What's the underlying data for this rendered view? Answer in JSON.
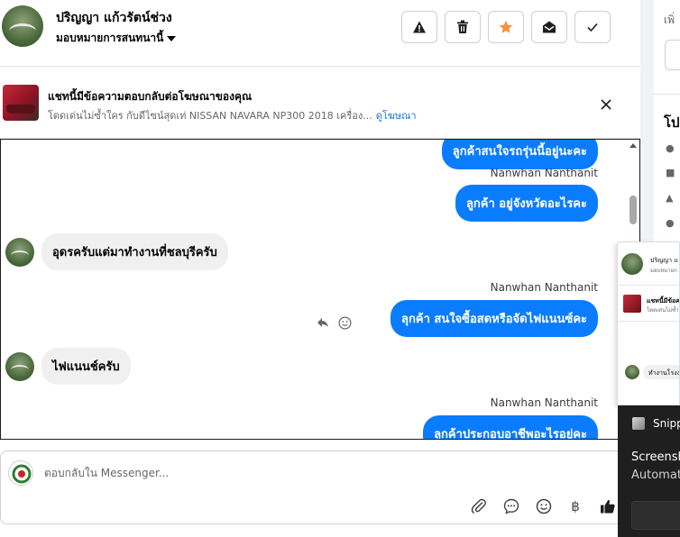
{
  "header": {
    "contact_name": "ปริญญา แก้วรัตน์ช่วง",
    "assign_label": "มอบหมายการสนทนานี้"
  },
  "ad_banner": {
    "title": "แชทนี้มีข้อความตอบกลับต่อโฆษณาของคุณ",
    "description": "โดดเด่นไม่ซ้ำใคร กับดีไซน์สุดเท่ NISSAN NAVARA NP300 2018 เครื่อง...",
    "link": "ดูโฆษณา"
  },
  "messages": [
    {
      "direction": "out",
      "text": "ลูกค้าสนใจรถรุ่นนี้อยู่นะคะ",
      "sender": ""
    },
    {
      "direction": "out",
      "text": "ลูกค้า อยู่จังหวัดอะไรคะ",
      "sender": "Nanwhan Nanthanit"
    },
    {
      "direction": "in",
      "text": "อุดรครับแต่มาทำงานที่ชลบุรีครับ",
      "sender": ""
    },
    {
      "direction": "out",
      "text": "ลุกค้า สนใจซื้อสดหรือจัดไฟแนนซ์คะ",
      "sender": "Nanwhan Nanthanit"
    },
    {
      "direction": "in",
      "text": "ไฟแนนช์ครับ",
      "sender": ""
    },
    {
      "direction": "out",
      "text": "ลูกค้าประกอบอาชีพอะไรอยู่คะ",
      "sender": "Nanwhan Nanthanit"
    }
  ],
  "composer": {
    "placeholder": "ตอบกลับใน Messenger..."
  },
  "side_panel": {
    "top_text": "เพิ่",
    "heading": "โป"
  },
  "mini_list": [
    {
      "title": "ปริญญา แ",
      "subtitle": "มอบหมายก"
    },
    {
      "title": "แชทนี้มีข้อค",
      "subtitle": "โดดเด่นไม่ซ้ำใ"
    },
    {
      "title": "ทำงานโรงง",
      "subtitle": ""
    }
  ],
  "notification": {
    "app_name": "Snipp",
    "title": "Screensh",
    "subtitle": "Automat"
  },
  "colors": {
    "outgoing_bubble": "#0a7cff",
    "incoming_bubble": "#f0f0f0",
    "link": "#1b74e4",
    "star": "#f5923e"
  }
}
